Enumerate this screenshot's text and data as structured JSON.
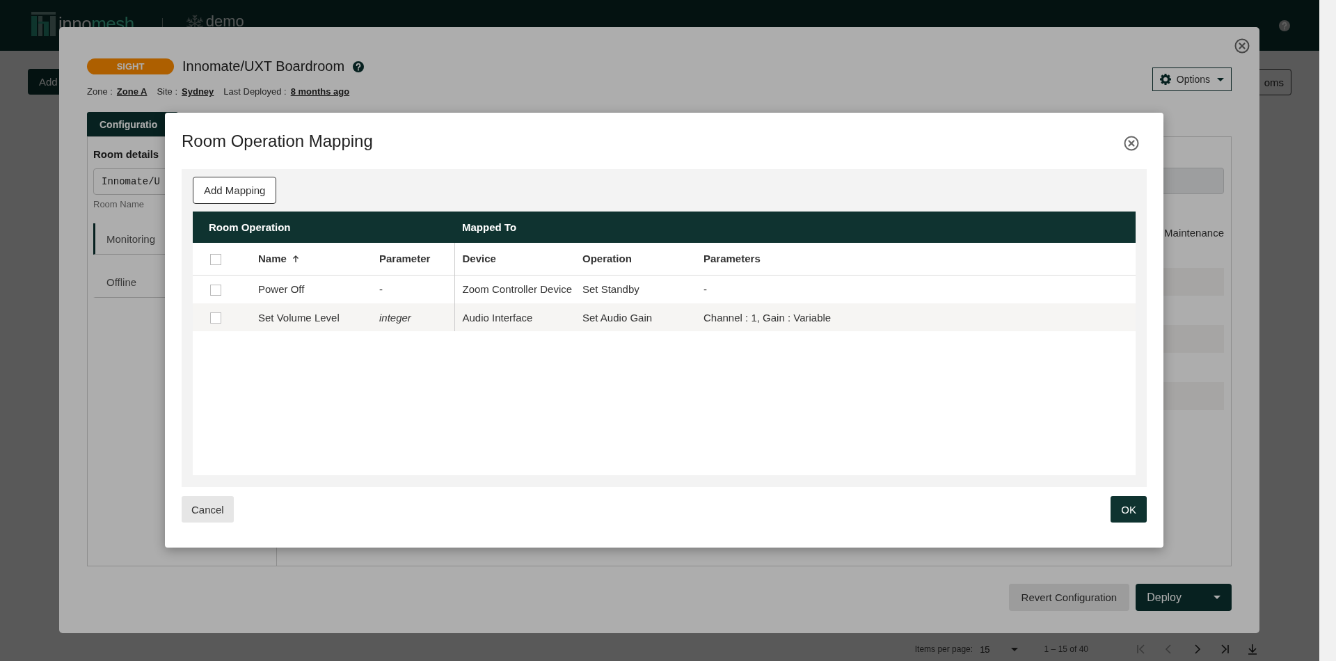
{
  "app_header": {
    "brand_parts": [
      "inno",
      "mesh"
    ],
    "tenant": "demo"
  },
  "page": {
    "left_button": "Add",
    "right_button": "oms",
    "pagination": {
      "items_per_page_label": "Items per page:",
      "page_size": "15",
      "range": "1 – 15 of 40"
    }
  },
  "room_dialog": {
    "product_badge": "SIGHT",
    "title": "Innomate/UXT Boardroom",
    "meta": [
      {
        "label": "Zone :",
        "value": "Zone A"
      },
      {
        "label": "Site :",
        "value": "Sydney"
      },
      {
        "label": "Last Deployed :",
        "value": "8 months ago"
      }
    ],
    "options_button": "Options",
    "tabs": [
      {
        "label": "Configuratio",
        "selected": true
      }
    ],
    "section_title": "Room details",
    "room_name_value": "Innomate/U",
    "room_name_label": "Room Name",
    "modes": [
      {
        "label": "Monitoring",
        "selected": true
      },
      {
        "label": "Offline",
        "selected": false
      }
    ],
    "right_option": "Maintenance",
    "revert_button": "Revert Configuration",
    "deploy_button": "Deploy"
  },
  "mapping_modal": {
    "title": "Room Operation Mapping",
    "add_button": "Add Mapping",
    "groups": [
      "Room Operation",
      "Mapped To"
    ],
    "select_all_checked": false,
    "columns": [
      {
        "label": "Name",
        "sorted": true
      },
      {
        "label": "Parameter",
        "sorted": false
      },
      {
        "label": "Device",
        "sorted": false
      },
      {
        "label": "Operation",
        "sorted": false
      },
      {
        "label": "Parameters",
        "sorted": false
      }
    ],
    "rows": [
      {
        "checked": false,
        "name": "Power Off",
        "parameter": "-",
        "parameter_is_type": false,
        "device": "Zoom Controller Device",
        "operation": "Set Standby",
        "parameters": "-"
      },
      {
        "checked": false,
        "name": "Set Volume Level",
        "parameter": "integer",
        "parameter_is_type": true,
        "device": "Audio Interface",
        "operation": "Set Audio Gain",
        "parameters": "Channel : 1, Gain : Variable"
      }
    ],
    "cancel_button": "Cancel",
    "ok_button": "OK"
  }
}
